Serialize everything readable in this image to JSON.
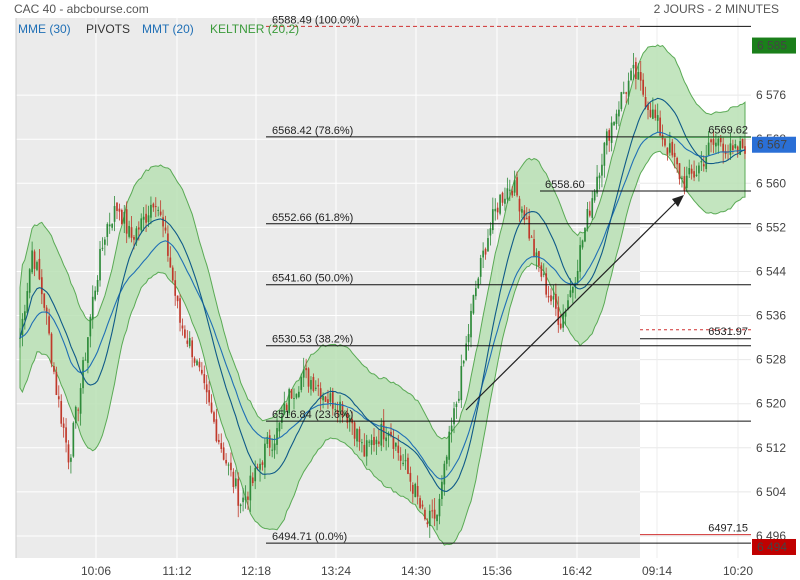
{
  "header": {
    "source": "CAC 40 - abcbourse.com",
    "period": "2 JOURS - 2 MINUTES"
  },
  "legend": [
    {
      "label": "MME (30)",
      "color": "#1f6fb5"
    },
    {
      "label": "PIVOTS",
      "color": "#333333"
    },
    {
      "label": "MMT (20)",
      "color": "#1f6fb5"
    },
    {
      "label": "KELTNER (20,2)",
      "color": "#3a9a3a"
    }
  ],
  "colors": {
    "up": "#2e8b3a",
    "down": "#c0392b",
    "band_fill": "#b9e0b4",
    "band_edge": "#5aaa55",
    "mme": "#1f6fb5",
    "mmt": "#0f5a88",
    "prev_day_bg": "#ebebeb",
    "last_price_tag": "#2a6fd6",
    "high_tag": "#1a7f1a",
    "low_tag": "#c00000"
  },
  "chart_data": {
    "type": "candlestick",
    "ylim": [
      6492,
      6590
    ],
    "y_ticks": [
      6496,
      6504,
      6512,
      6520,
      6528,
      6536,
      6544,
      6552,
      6560,
      6568,
      6576
    ],
    "x_ticks": [
      "10:06",
      "11:12",
      "12:18",
      "13:24",
      "14:30",
      "15:36",
      "16:42",
      "09:14",
      "10:20"
    ],
    "fib_levels": [
      {
        "value": 6588.49,
        "label": "6588.49",
        "pct": "(100.0%)"
      },
      {
        "value": 6568.42,
        "label": "6568.42",
        "pct": "(78.6%)"
      },
      {
        "value": 6552.66,
        "label": "6552.66",
        "pct": "(61.8%)"
      },
      {
        "value": 6541.6,
        "label": "6541.60",
        "pct": "(50.0%)"
      },
      {
        "value": 6530.53,
        "label": "6530.53",
        "pct": "(38.2%)"
      },
      {
        "value": 6516.84,
        "label": "6516.84",
        "pct": "(23.6%)"
      },
      {
        "value": 6494.71,
        "label": "6494.71",
        "pct": "(0.0%)"
      }
    ],
    "pivot_levels": [
      {
        "value": 6558.6,
        "label": "6558.60"
      },
      {
        "value": 6531.97,
        "label": "6531.97"
      },
      {
        "value": 6569.62,
        "label": "6569.62"
      },
      {
        "value": 6497.15,
        "label": "6497.15"
      }
    ],
    "last_price": "6 567",
    "day_high": "6 585",
    "day_low": "6 494",
    "waypoints": [
      [
        6532,
        6548,
        6538,
        6522,
        6510,
        6524,
        6540,
        6552,
        6556,
        6550,
        6553,
        6558,
        6548,
        6535,
        6530,
        6522,
        6515,
        6508,
        6502,
        6506,
        6512,
        6515,
        6522,
        6525,
        6524,
        6521,
        6520,
        6517,
        6511,
        6514,
        6516,
        6510,
        6505,
        6498,
        6500,
        6514,
        6526,
        6540,
        6550,
        6557,
        6560,
        6555,
        6546,
        6540,
        6535,
        6542,
        6552,
        6562,
        6570,
        6576,
        6580,
        6575,
        6570,
        6565,
        6560,
        6562,
        6566,
        6568,
        6565,
        6567
      ]
    ]
  }
}
